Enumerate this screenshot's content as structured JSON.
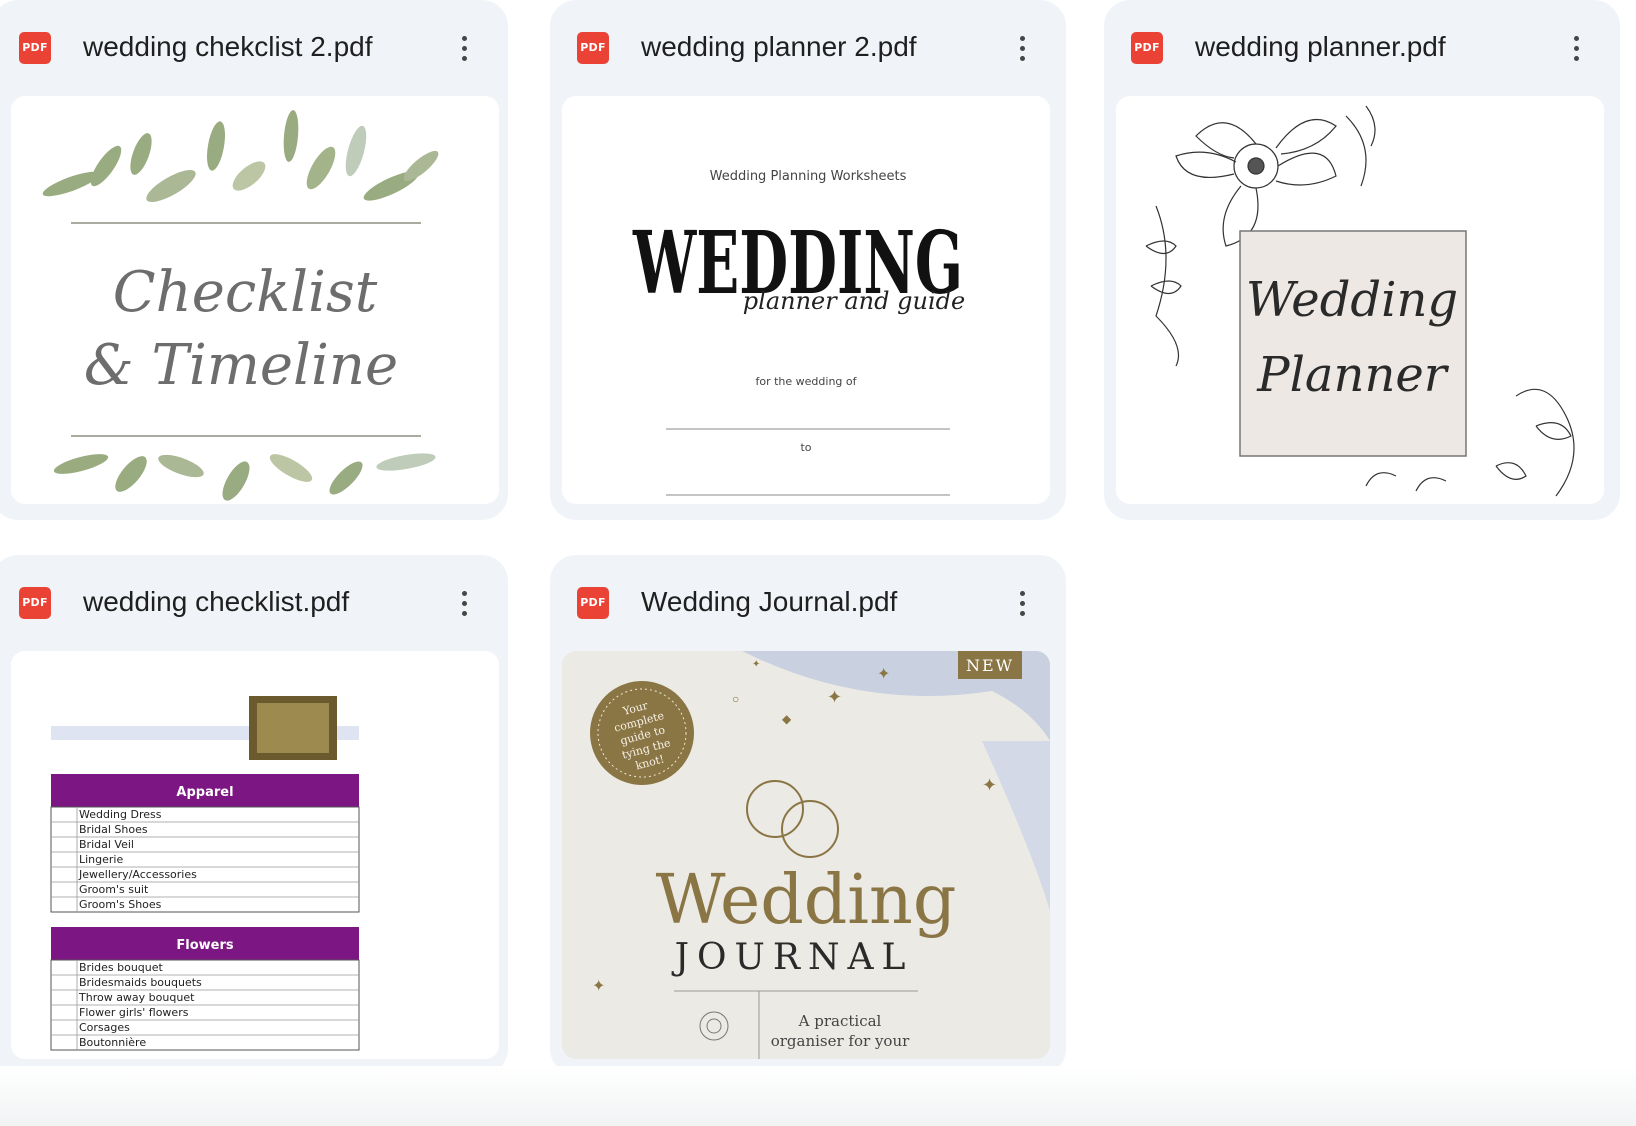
{
  "files": [
    {
      "name": "wedding chekclist 2.pdf",
      "badge": "PDF",
      "preview": {
        "title_line1": "Checklist",
        "title_line2": "& Timeline"
      }
    },
    {
      "name": "wedding planner 2.pdf",
      "badge": "PDF",
      "preview": {
        "kicker": "Wedding Planning Worksheets",
        "title": "WEDDING",
        "subtitle": "planner and guide",
        "line1": "for the wedding of",
        "line2": "to"
      }
    },
    {
      "name": "wedding planner.pdf",
      "badge": "PDF",
      "preview": {
        "title_line1": "Wedding",
        "title_line2": "Planner"
      }
    },
    {
      "name": "wedding checklist.pdf",
      "badge": "PDF",
      "preview": {
        "sections": [
          {
            "title": "Apparel",
            "items": [
              "Wedding Dress",
              "Bridal Shoes",
              "Bridal Veil",
              "Lingerie",
              "Jewellery/Accessories",
              "Groom's suit",
              "Groom's Shoes"
            ]
          },
          {
            "title": "Flowers",
            "items": [
              "Brides bouquet",
              "Bridesmaids bouquets",
              "Throw away bouquet",
              "Flower girls' flowers",
              "Corsages",
              "Boutonnière"
            ]
          }
        ]
      }
    },
    {
      "name": "Wedding Journal.pdf",
      "badge": "PDF",
      "preview": {
        "new_tag": "NEW",
        "seal_lines": [
          "Your",
          "complete",
          "guide to",
          "tying the",
          "knot!"
        ],
        "title": "Wedding",
        "subtitle": "JOURNAL",
        "tagline_line1": "A practical",
        "tagline_line2": "organiser for your"
      }
    }
  ],
  "colors": {
    "card_bg": "#f0f4f9",
    "pdf_red": "#ea4335",
    "checklist_purple": "#7b1682",
    "journal_gold": "#8a7545"
  }
}
